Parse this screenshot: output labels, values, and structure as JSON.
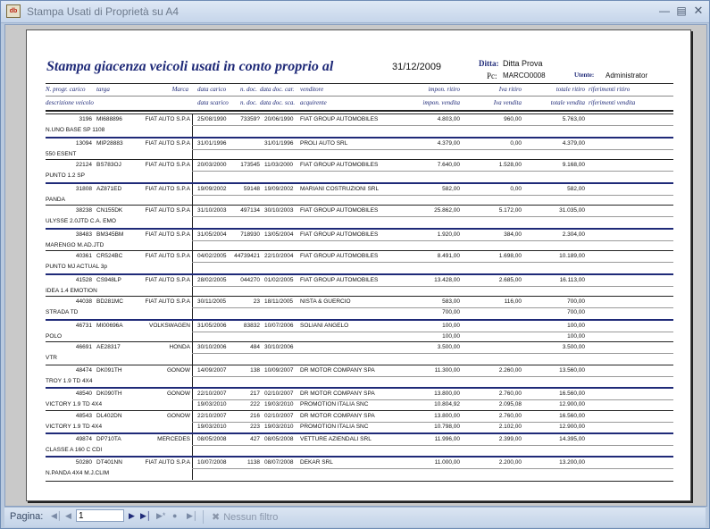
{
  "window": {
    "title": "Stampa Usati di Proprietà su A4"
  },
  "report": {
    "title": "Stampa giacenza veicoli usati in conto proprio al",
    "date": "31/12/2009",
    "ditta_label": "Ditta:",
    "ditta_value": "Ditta Prova",
    "pc_label": "Pc:",
    "pc_value": "MARCO0008",
    "utente_label": "Utente:",
    "utente_value": "Administrator"
  },
  "headers": {
    "row1": [
      "N. progr. carico",
      "targa",
      "Marca",
      "data carico",
      "n. doc.",
      "data doc.",
      "car.",
      "venditore",
      "impon. ritiro",
      "Iva ritiro",
      "totale ritiro",
      "riferimenti ritiro"
    ],
    "row2": [
      "descrizione veicolo",
      "data scarico",
      "n. doc.",
      "data doc.",
      "sca.",
      "acquirente",
      "impon. vendita",
      "Iva vendita",
      "totale vendita",
      "riferimenti vendita"
    ]
  },
  "rows": [
    {
      "num": "3196",
      "targa": "MI688896",
      "marca": "FIAT AUTO S.P.A",
      "desc": "N.UNO BASE SP 1108",
      "lines": [
        [
          "25/08/1990",
          "73359?",
          "20/06/1990",
          "FIAT GROUP AUTOMOBILES",
          "4.803,00",
          "960,00",
          "5.763,00"
        ],
        [
          "",
          "",
          "",
          "",
          "",
          "",
          ""
        ]
      ]
    },
    {
      "num": "13094",
      "targa": "MIP28883",
      "marca": "FIAT AUTO S.P.A",
      "desc": "550 ESENT",
      "lines": [
        [
          "31/01/1996",
          "",
          "31/01/1996",
          "PROLI AUTO SRL",
          "4.379,00",
          "0,00",
          "4.379,00"
        ],
        [
          "",
          "",
          "",
          "",
          "",
          "",
          ""
        ]
      ]
    },
    {
      "num": "22124",
      "targa": "BS783OJ",
      "marca": "FIAT AUTO S.P.A",
      "desc": "PUNTO 1.2 SP",
      "lines": [
        [
          "20/03/2000",
          "173545",
          "11/03/2000",
          "FIAT GROUP AUTOMOBILES",
          "7.640,00",
          "1.528,00",
          "9.168,00"
        ],
        [
          "",
          "",
          "",
          "",
          "",
          "",
          ""
        ]
      ]
    },
    {
      "num": "31808",
      "targa": "AZ871ED",
      "marca": "FIAT AUTO S.P.A",
      "desc": "PANDA",
      "lines": [
        [
          "19/09/2002",
          "59148",
          "19/09/2002",
          "MARIANI COSTRUZIONI SRL",
          "582,00",
          "0,00",
          "582,00"
        ],
        [
          "",
          "",
          "",
          "",
          "",
          "",
          ""
        ]
      ]
    },
    {
      "num": "38238",
      "targa": "CN155DK",
      "marca": "FIAT AUTO S.P.A",
      "desc": "ULYSSE 2.0JTD C.A. EMO",
      "lines": [
        [
          "31/10/2003",
          "497134",
          "30/10/2003",
          "FIAT GROUP AUTOMOBILES",
          "25.862,00",
          "5.172,00",
          "31.035,00"
        ],
        [
          "",
          "",
          "",
          "",
          "",
          "",
          ""
        ]
      ]
    },
    {
      "num": "38483",
      "targa": "BM345BM",
      "marca": "FIAT AUTO S.P.A",
      "desc": "MARENGO M.AD.JTD",
      "lines": [
        [
          "31/05/2004",
          "718930",
          "13/05/2004",
          "FIAT GROUP AUTOMOBILES",
          "1.920,00",
          "384,00",
          "2.304,00"
        ],
        [
          "",
          "",
          "",
          "",
          "",
          "",
          ""
        ]
      ]
    },
    {
      "num": "40361",
      "targa": "CR524BC",
      "marca": "FIAT AUTO S.P.A",
      "desc": "PUNTO MJ ACTUAL 3p",
      "lines": [
        [
          "04/02/2005",
          "44739421",
          "22/10/2004",
          "FIAT GROUP AUTOMOBILES",
          "8.491,00",
          "1.698,00",
          "10.189,00"
        ],
        [
          "",
          "",
          "",
          "",
          "",
          "",
          ""
        ]
      ]
    },
    {
      "num": "41528",
      "targa": "CS948LP",
      "marca": "FIAT AUTO S.P.A",
      "desc": "IDEA 1.4 EMOTION",
      "lines": [
        [
          "28/02/2005",
          "044270",
          "01/02/2005",
          "FIAT GROUP AUTOMOBILES",
          "13.428,00",
          "2.685,00",
          "16.113,00"
        ],
        [
          "",
          "",
          "",
          "",
          "",
          "",
          ""
        ]
      ]
    },
    {
      "num": "44038",
      "targa": "BD281MC",
      "marca": "FIAT AUTO S.P.A",
      "desc": "STRADA TD",
      "lines": [
        [
          "30/11/2005",
          "23",
          "18/11/2005",
          "NISTA & GUERCIO",
          "583,00",
          "116,00",
          "700,00"
        ],
        [
          "",
          "",
          "",
          "",
          "700,00",
          "",
          "700,00"
        ]
      ]
    },
    {
      "num": "46731",
      "targa": "MI00696A",
      "marca": "VOLKSWAGEN",
      "desc": "POLO",
      "lines": [
        [
          "31/05/2006",
          "83832",
          "10/07/2006",
          "SOLIANI ANGELO",
          "100,00",
          "",
          "100,00"
        ],
        [
          "",
          "",
          "",
          "",
          "100,00",
          "",
          "100,00"
        ]
      ]
    },
    {
      "num": "46691",
      "targa": "AE28317",
      "marca": "HONDA",
      "desc": "VTR",
      "lines": [
        [
          "30/10/2006",
          "484",
          "30/10/2006",
          "",
          "3.500,00",
          "",
          "3.500,00"
        ],
        [
          "",
          "",
          "",
          "",
          "",
          "",
          ""
        ]
      ]
    },
    {
      "num": "48474",
      "targa": "DK091TH",
      "marca": "GONOW",
      "desc": "TROY 1.9 TD 4X4",
      "lines": [
        [
          "14/09/2007",
          "138",
          "10/09/2007",
          "DR MOTOR COMPANY SPA",
          "11.300,00",
          "2.260,00",
          "13.560,00"
        ],
        [
          "",
          "",
          "",
          "",
          "",
          "",
          ""
        ]
      ]
    },
    {
      "num": "48540",
      "targa": "DK090TH",
      "marca": "GONOW",
      "desc": "VICTORY 1.9 TD 4X4",
      "lines": [
        [
          "22/10/2007",
          "217",
          "02/10/2007",
          "DR MOTOR COMPANY SPA",
          "13.800,00",
          "2.760,00",
          "16.560,00"
        ],
        [
          "19/03/2010",
          "222",
          "19/03/2010",
          "PROMOTION ITALIA SNC",
          "10.804,92",
          "2.095,08",
          "12.900,00"
        ]
      ]
    },
    {
      "num": "48543",
      "targa": "DL402DN",
      "marca": "GONOW",
      "desc": "VICTORY 1.9 TD 4X4",
      "lines": [
        [
          "22/10/2007",
          "216",
          "02/10/2007",
          "DR MOTOR COMPANY SPA",
          "13.800,00",
          "2.760,00",
          "16.560,00"
        ],
        [
          "19/03/2010",
          "223",
          "19/03/2010",
          "PROMOTION ITALIA SNC",
          "10.798,00",
          "2.102,00",
          "12.900,00"
        ]
      ]
    },
    {
      "num": "49874",
      "targa": "DP710TA",
      "marca": "MERCEDES",
      "desc": "CLASSE A 160 C CDI",
      "lines": [
        [
          "08/05/2008",
          "427",
          "08/05/2008",
          "VETTURE AZIENDALI SRL",
          "11.996,00",
          "2.399,00",
          "14.395,00"
        ],
        [
          "",
          "",
          "",
          "",
          "",
          "",
          ""
        ]
      ]
    },
    {
      "num": "50280",
      "targa": "DT401NN",
      "marca": "FIAT AUTO S.P.A",
      "desc": "N.PANDA 4X4 M.J.CLIM",
      "lines": [
        [
          "10/07/2008",
          "1138",
          "08/07/2008",
          "DEKAR SRL",
          "11.000,00",
          "2.200,00",
          "13.200,00"
        ],
        [
          "",
          "",
          "",
          "",
          "",
          "",
          ""
        ]
      ]
    }
  ],
  "statusbar": {
    "page_label": "Pagina:",
    "page_value": "1",
    "filter_label": "Nessun filtro"
  }
}
